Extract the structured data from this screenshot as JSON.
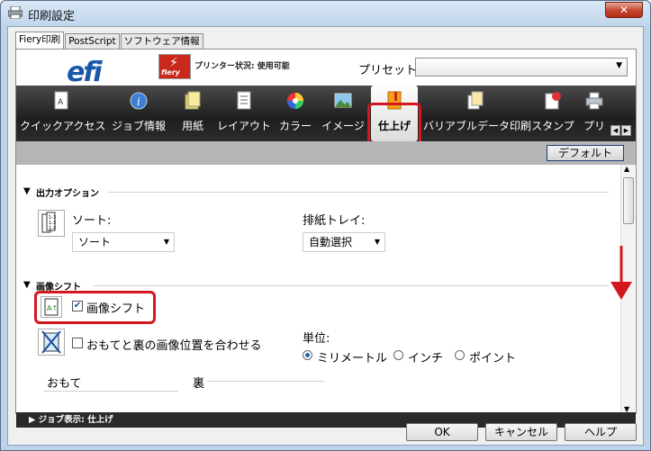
{
  "window": {
    "title": "印刷設定",
    "close_label": "✕"
  },
  "tabs": [
    "Fiery印刷",
    "PostScript",
    "ソフトウェア情報"
  ],
  "header": {
    "logo_text": "efi",
    "fiery_text": "fiery",
    "printer_status": "プリンター状況: 使用可能",
    "preset_label": "プリセット:",
    "preset_value": ""
  },
  "toolbar": {
    "items": [
      "クイックアクセス",
      "ジョブ情報",
      "用紙",
      "レイアウト",
      "カラー",
      "イメージ",
      "仕上げ",
      "バリアブルデータ印刷",
      "スタンプ",
      "プリ"
    ],
    "selected": "仕上げ"
  },
  "default_button": "デフォルト",
  "output_section": {
    "title": "出力オプション",
    "sort_label": "ソート:",
    "sort_value": "ソート",
    "tray_label": "排紙トレイ:",
    "tray_value": "自動選択"
  },
  "shift_section": {
    "title": "画像シフト",
    "shift_checkbox_label": "画像シフト",
    "shift_checked": true,
    "align_checkbox_label": "おもてと裏の画像位置を合わせる",
    "align_checked": false,
    "unit_label": "単位:",
    "units": [
      "ミリメートル",
      "インチ",
      "ポイント"
    ],
    "unit_selected": "ミリメートル",
    "front_label": "おもて",
    "back_label": "裏"
  },
  "footer": {
    "job_display": "ジョブ表示: 仕上げ"
  },
  "buttons": {
    "ok": "OK",
    "cancel": "キャンセル",
    "help": "ヘルプ"
  },
  "colors": {
    "accent_red": "#d4171e",
    "toolbar_dark": "#1e1e1e"
  }
}
